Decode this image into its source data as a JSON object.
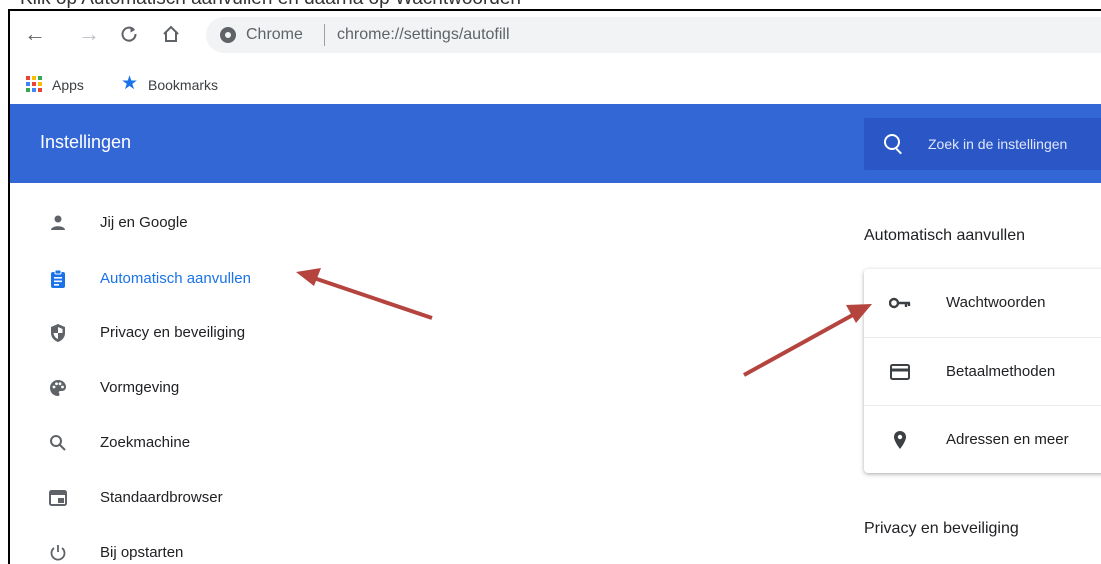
{
  "caption": "Klik op Automatisch aanvullen en daarna op Wachtwoorden",
  "browser": {
    "site_label": "Chrome",
    "url": "chrome://settings/autofill"
  },
  "bookmarks_bar": {
    "apps_label": "Apps",
    "bookmarks_label": "Bookmarks"
  },
  "header": {
    "title": "Instellingen",
    "search_placeholder": "Zoek in de instellingen",
    "color": "#3367d6"
  },
  "sidebar": {
    "items": [
      {
        "label": "Jij en Google",
        "icon": "person-icon",
        "active": false
      },
      {
        "label": "Automatisch aanvullen",
        "icon": "clipboard-icon",
        "active": true
      },
      {
        "label": "Privacy en beveiliging",
        "icon": "shield-icon",
        "active": false
      },
      {
        "label": "Vormgeving",
        "icon": "palette-icon",
        "active": false
      },
      {
        "label": "Zoekmachine",
        "icon": "search-icon",
        "active": false
      },
      {
        "label": "Standaardbrowser",
        "icon": "browser-window-icon",
        "active": false
      },
      {
        "label": "Bij opstarten",
        "icon": "power-icon",
        "active": false
      }
    ],
    "active_color": "#1a73e8"
  },
  "main": {
    "autofill_title": "Automatisch aanvullen",
    "autofill_items": [
      {
        "label": "Wachtwoorden",
        "icon": "key-icon"
      },
      {
        "label": "Betaalmethoden",
        "icon": "credit-card-icon"
      },
      {
        "label": "Adressen en meer",
        "icon": "location-pin-icon"
      }
    ],
    "privacy_title": "Privacy en beveiliging"
  },
  "annotation_color": "#b5443e"
}
